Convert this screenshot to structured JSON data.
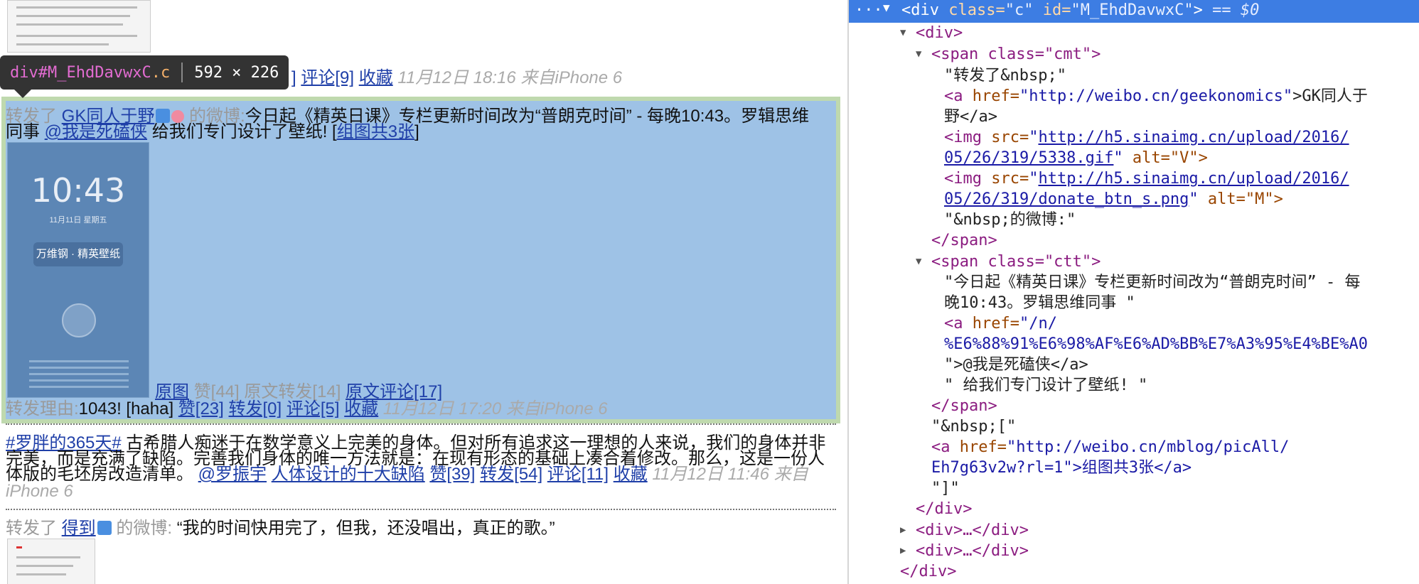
{
  "weibo": {
    "top_actions": {
      "fwd_suffix": "]",
      "comment": "评论[9]",
      "fav": "收藏",
      "time": "11月12日 18:16 来自iPhone 6"
    },
    "tooltip": {
      "tag": "div",
      "id": "#M_EhdDavwxC",
      "cls": ".c",
      "size": "592 × 226"
    },
    "post1": {
      "forward_prefix": "转发了",
      "user": "GK同人于野",
      "user_suffix": "的微博:",
      "text_line1": "今日起《精英日课》专栏更新时间改为“普朗克时间” - 每晚10:43。罗辑思维",
      "text_line2_a": "同事",
      "mention": "@我是死磕侠",
      "text_line2_b": "给我们专门设计了壁纸!  [",
      "album": "组图共3张",
      "album_close": "]",
      "lock_time": "10:43",
      "lock_date": "11月11日 星期五",
      "lock_pill": "万维钢 · 精英壁纸",
      "orig_pic": "原图",
      "likes": "赞[44]",
      "orig_fwd": "原文转发[14]",
      "orig_comment": "原文评论[17]",
      "reason_label": "转发理由:",
      "reason_text": "1043!  [haha]",
      "like2": "赞[23]",
      "fwd2": "转发[0]",
      "comment2": "评论[5]",
      "fav2": "收藏",
      "time2": "11月12日 17:20 来自iPhone 6"
    },
    "post2": {
      "hashtag": "#罗胖的365天#",
      "line1": "古希腊人痴迷于在数学意义上完美的身体。但对所有追求这一理想的人来说，我们的身体并非",
      "line2": "完美，而是充满了缺陷。完善我们身体的唯一方法就是：在现有形态的基础上凑合着修改。那么，这是一份人",
      "line3": "体版的毛坯房改造清单。",
      "mention": "@罗振宇",
      "link": "人体设计的十大缺陷",
      "like": "赞[39]",
      "fwd": "转发[54]",
      "comment": "评论[11]",
      "fav": "收藏",
      "time": "11月12日 11:46 来自",
      "time2": "iPhone 6"
    },
    "post3": {
      "forward_prefix": "转发了",
      "user": "得到",
      "user_suffix": "的微博:",
      "text": "“我的时间快用完了，但我，还没唱出，真正的歌。”"
    }
  },
  "devtools": {
    "sel_dots": "···",
    "sel_tag_open": "<div",
    "sel_class_attr": "class=",
    "sel_class_val": "\"c\"",
    "sel_id_attr": "id=",
    "sel_id_val": "\"M_EhdDavwxC\"",
    "sel_close": ">",
    "sel_eq": "== $0",
    "lines": {
      "div_open": "<div>",
      "span_cmt": "<span class=\"cmt\">",
      "txt_fwd": "\"转发了&nbsp;\"",
      "a_href_attr": "href=",
      "a_href_val": "\"http://weibo.cn/geekonomics\"",
      "a_text1": ">GK同人于",
      "a_text2": "野</a>",
      "img1_src1": "http://h5.sinaimg.cn/upload/2016/",
      "img1_src2": "05/26/319/5338.gif",
      "img1_alt": "alt=\"V\">",
      "img2_src1": "http://h5.sinaimg.cn/upload/2016/",
      "img2_src2": "05/26/319/donate_btn_s.png",
      "img2_alt": "alt=\"M\">",
      "txt_weibo": "\"&nbsp;的微博:\"",
      "span_close": "</span>",
      "span_ctt": "<span class=\"ctt\">",
      "ctt_txt1": "\"今日起《精英日课》专栏更新时间改为“普朗克时间” - 每",
      "ctt_txt2": "晚10:43。罗辑思维同事 \"",
      "a2_href1": "\"/n/",
      "a2_href2": "%E6%88%91%E6%98%AF%E6%AD%BB%E7%A3%95%E4%BE%A0",
      "a2_text": "\">@我是死磕侠</a>",
      "ctt_txt3": "\" 给我们专门设计了壁纸! \"",
      "span_close2": "</span>",
      "nbsp_bracket": "\"&nbsp;[\"",
      "a3_href1": "\"http://weibo.cn/mblog/picAll/",
      "a3_href2": "Eh7g63v2w?rl=1\">组图共3张</a>",
      "close_bracket": "\"]\"",
      "div_close": "</div>",
      "div_collapsed1": "<div>…</div>",
      "div_collapsed2": "<div>…</div>",
      "div_close2": "</div>"
    }
  }
}
